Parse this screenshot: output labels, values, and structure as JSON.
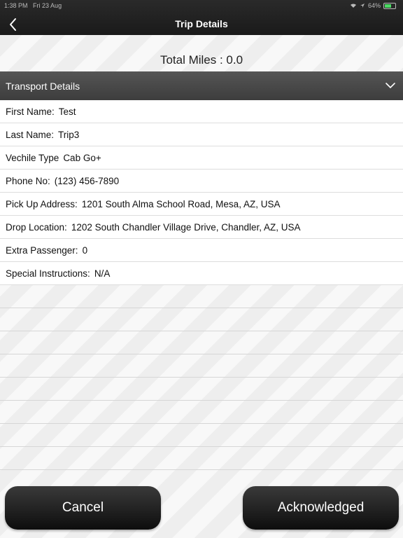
{
  "status_bar": {
    "time": "1:38 PM",
    "date": "Fri 23 Aug",
    "battery": "64%",
    "battery_level": 0.64
  },
  "header": {
    "title": "Trip Details",
    "back_icon": "chevron-left-icon"
  },
  "total_miles": "Total Miles : 0.0",
  "section": {
    "label": "Transport Details",
    "icon": "chevron-down-icon"
  },
  "details": [
    {
      "key": "First Name:",
      "value": "Test"
    },
    {
      "key": "Last Name:",
      "value": "Trip3"
    },
    {
      "key": "Vechile Type",
      "value": "Cab Go+"
    },
    {
      "key": "Phone No:",
      "value": "(123) 456-7890"
    },
    {
      "key": "Pick Up Address:",
      "value": "1201 South Alma School Road, Mesa, AZ, USA"
    },
    {
      "key": "Drop Location:",
      "value": "1202 South Chandler Village Drive, Chandler, AZ, USA"
    },
    {
      "key": "Extra Passenger:",
      "value": "0"
    },
    {
      "key": "Special Instructions:",
      "value": "N/A"
    }
  ],
  "buttons": {
    "cancel": "Cancel",
    "acknowledged": "Acknowledged"
  }
}
